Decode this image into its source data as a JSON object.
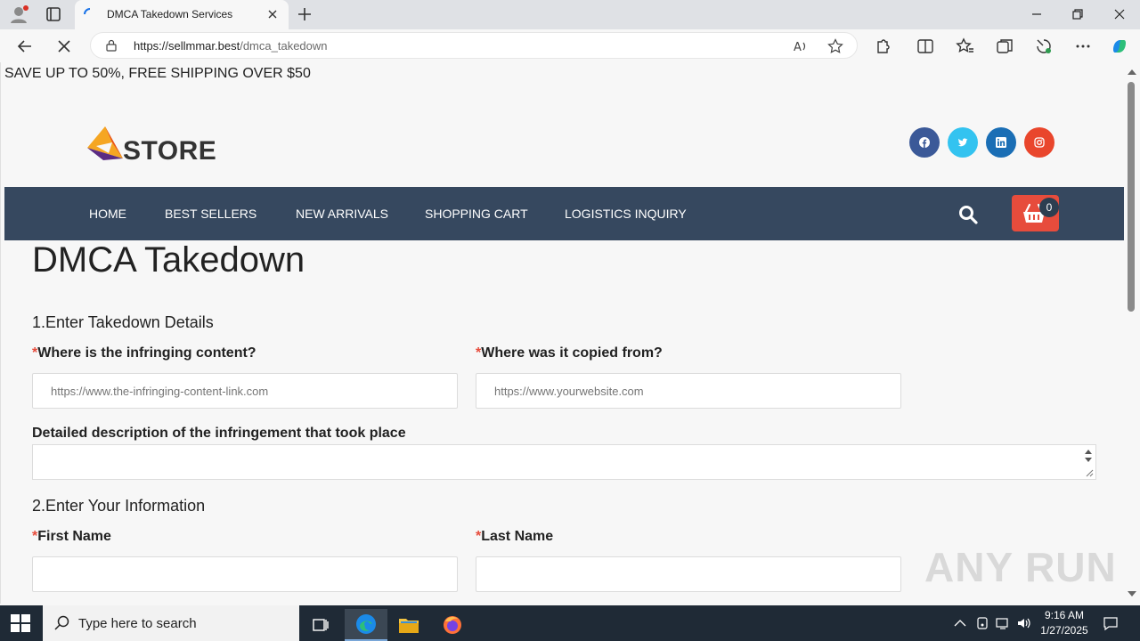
{
  "browser": {
    "tab_title": "DMCA Takedown Services",
    "url_host": "https://sellmmar.best",
    "url_path": "/dmca_takedown"
  },
  "page": {
    "promo": "SAVE UP TO 50%, FREE SHIPPING OVER $50",
    "logo_text": "STORE",
    "nav": {
      "items": [
        "HOME",
        "BEST SELLERS",
        "NEW ARRIVALS",
        "SHOPPING CART",
        "LOGISTICS INQUIRY"
      ],
      "cart_count": "0"
    },
    "social": [
      {
        "name": "facebook",
        "color": "#3b5998"
      },
      {
        "name": "twitter",
        "color": "#33c3f0"
      },
      {
        "name": "linkedin",
        "color": "#1a6eb5"
      },
      {
        "name": "instagram",
        "color": "#e9462c"
      }
    ],
    "title": "DMCA Takedown",
    "section1": "1.Enter Takedown Details",
    "infringing_label": "Where is the infringing content?",
    "infringing_placeholder": "https://www.the-infringing-content-link.com",
    "copied_label": "Where was it copied from?",
    "copied_placeholder": "https://www.yourwebsite.com",
    "description_label": "Detailed description of the infringement that took place",
    "section2": "2.Enter Your Information",
    "first_name_label": "First Name",
    "last_name_label": "Last Name",
    "required_mark": "*"
  },
  "watermark": "ANY RUN",
  "taskbar": {
    "search_placeholder": "Type here to search",
    "time": "9:16 AM",
    "date": "1/27/2025"
  }
}
